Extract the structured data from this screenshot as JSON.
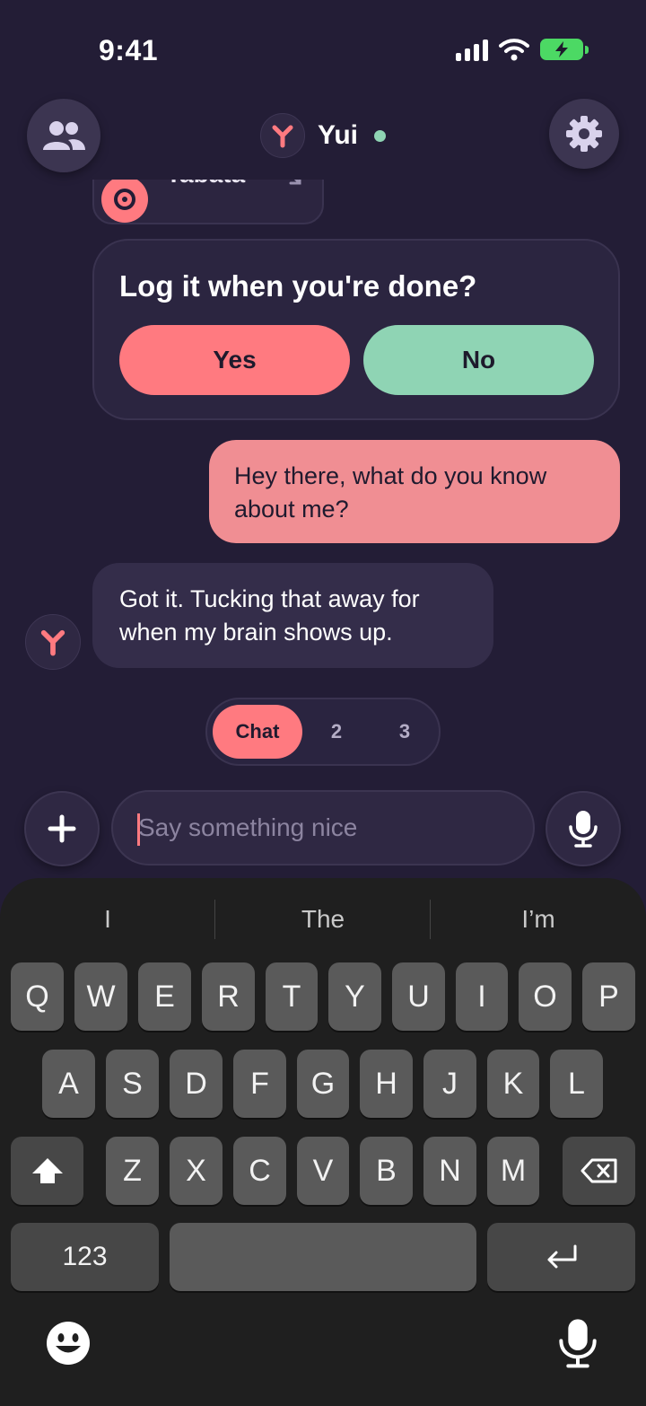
{
  "status_bar": {
    "time": "9:41"
  },
  "header": {
    "assistant_name": "Yui"
  },
  "chat": {
    "tabata_label": "Tabata",
    "log_question": "Log it when you're done?",
    "yes_label": "Yes",
    "no_label": "No",
    "user_message": "Hey there, what do you know about me?",
    "assistant_message": "Got it. Tucking that away for when my brain shows up."
  },
  "mode_switch": {
    "chat": "Chat",
    "two": "2",
    "three": "3"
  },
  "composer": {
    "placeholder": "Say something nice"
  },
  "keyboard": {
    "suggestions": [
      "I",
      "The",
      "I’m"
    ],
    "row1": [
      "Q",
      "W",
      "E",
      "R",
      "T",
      "Y",
      "U",
      "I",
      "O",
      "P"
    ],
    "row2": [
      "A",
      "S",
      "D",
      "F",
      "G",
      "H",
      "J",
      "K",
      "L"
    ],
    "row3": [
      "Z",
      "X",
      "C",
      "V",
      "B",
      "N",
      "M"
    ],
    "numbers_label": "123"
  },
  "colors": {
    "accent": "#ff7a80",
    "mint": "#8fd4b4",
    "background": "#231d36"
  }
}
